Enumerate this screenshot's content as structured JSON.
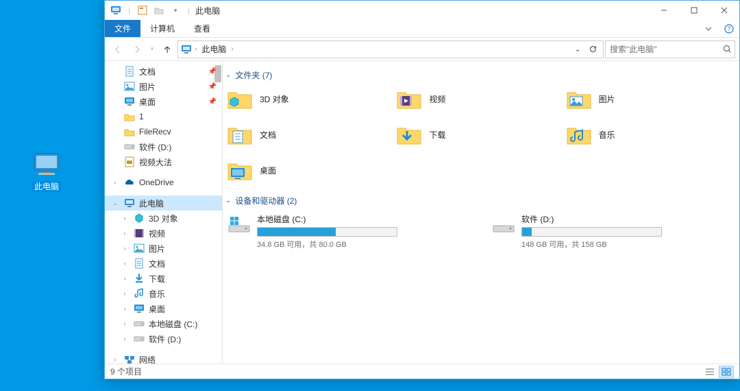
{
  "desktop": {
    "this_pc": "此电脑"
  },
  "titlebar": {
    "title": "此电脑"
  },
  "ribbon": {
    "file": "文件",
    "computer": "计算机",
    "view": "查看"
  },
  "address": {
    "location": "此电脑",
    "search_placeholder": "搜索\"此电脑\""
  },
  "sidebar": {
    "items": [
      {
        "label": "文档",
        "icon": "doc",
        "pinned": true
      },
      {
        "label": "图片",
        "icon": "pic",
        "pinned": true
      },
      {
        "label": "桌面",
        "icon": "desktop",
        "pinned": true
      },
      {
        "label": "1",
        "icon": "folder"
      },
      {
        "label": "FileRecv",
        "icon": "folder"
      },
      {
        "label": "软件 (D:)",
        "icon": "drive"
      },
      {
        "label": "视频大法",
        "icon": "video-file"
      }
    ],
    "onedrive": "OneDrive",
    "this_pc": "此电脑",
    "pc_children": [
      {
        "label": "3D 对象",
        "icon": "3d"
      },
      {
        "label": "视频",
        "icon": "video"
      },
      {
        "label": "图片",
        "icon": "pic"
      },
      {
        "label": "文档",
        "icon": "doc"
      },
      {
        "label": "下载",
        "icon": "download"
      },
      {
        "label": "音乐",
        "icon": "music"
      },
      {
        "label": "桌面",
        "icon": "desktop"
      },
      {
        "label": "本地磁盘 (C:)",
        "icon": "drive-c"
      },
      {
        "label": "软件 (D:)",
        "icon": "drive"
      }
    ],
    "network": "网络"
  },
  "groups": {
    "folders_header": "文件夹 (7)",
    "drives_header": "设备和驱动器 (2)"
  },
  "folders": [
    {
      "name": "3D 对象",
      "icon": "3d"
    },
    {
      "name": "视频",
      "icon": "video"
    },
    {
      "name": "图片",
      "icon": "pic"
    },
    {
      "name": "文档",
      "icon": "doc"
    },
    {
      "name": "下载",
      "icon": "download"
    },
    {
      "name": "音乐",
      "icon": "music"
    },
    {
      "name": "桌面",
      "icon": "desktop"
    }
  ],
  "drives": [
    {
      "name": "本地磁盘 (C:)",
      "free": "34.8 GB 可用，共 80.0 GB",
      "fill_pct": 56,
      "os": true
    },
    {
      "name": "软件 (D:)",
      "free": "148 GB 可用，共 158 GB",
      "fill_pct": 7,
      "os": false
    }
  ],
  "status": {
    "count": "9 个项目"
  }
}
